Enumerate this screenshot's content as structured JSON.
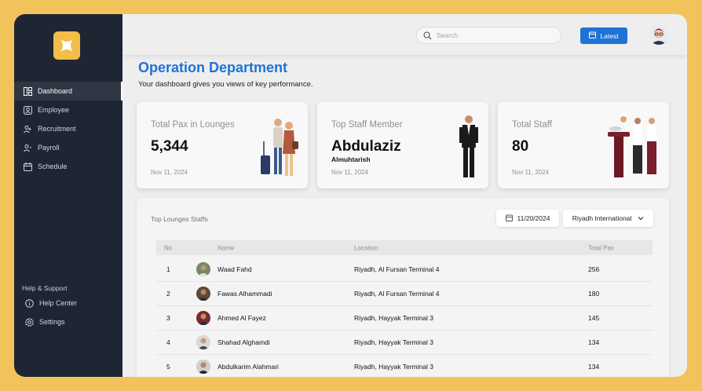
{
  "sidebar": {
    "items": [
      {
        "label": "Dashboard",
        "icon": "dashboard-icon",
        "active": true
      },
      {
        "label": "Employee",
        "icon": "employee-icon"
      },
      {
        "label": "Recruitment",
        "icon": "recruitment-icon"
      },
      {
        "label": "Payroll",
        "icon": "payroll-icon"
      },
      {
        "label": "Schedule",
        "icon": "schedule-icon"
      }
    ],
    "support_title": "Help & Support",
    "support_items": [
      {
        "label": "Help Center",
        "icon": "info-icon"
      },
      {
        "label": "Settings",
        "icon": "gear-icon"
      }
    ]
  },
  "header": {
    "search_placeholder": "Search",
    "latest_label": "Latest"
  },
  "page": {
    "title": "Operation Department",
    "subtitle": "Your dashboard gives you views of key performance."
  },
  "cards": [
    {
      "label": "Total Pax in Lounges",
      "value": "5,344",
      "sub": "",
      "date": "Nov 11, 2024"
    },
    {
      "label": "Top Staff Member",
      "value": "Abdulaziz",
      "sub": "Almuhtarish",
      "date": "Nov 11, 2024"
    },
    {
      "label": "Total Staff",
      "value": "80",
      "sub": "",
      "date": "Nov 11, 2024"
    }
  ],
  "table": {
    "title": "Top Lounges Staffs",
    "date_filter": "11/20/2024",
    "location_filter": "Riyadh International",
    "columns": [
      "No",
      "Name",
      "Location",
      "Total Pax"
    ],
    "rows": [
      {
        "no": "1",
        "name": "Waad Fahd",
        "location": "Riyadh, Al Fursan Terminal 4",
        "pax": "256"
      },
      {
        "no": "2",
        "name": "Fawas Alhammadi",
        "location": "Riyadh, Al Fursan Terminal 4",
        "pax": "180"
      },
      {
        "no": "3",
        "name": "Ahmed Al Fayez",
        "location": "Riyadh, Hayyak Terminal 3",
        "pax": "145"
      },
      {
        "no": "4",
        "name": "Shahad Alghamdi",
        "location": "Riyadh, Hayyak Terminal 3",
        "pax": "134"
      },
      {
        "no": "5",
        "name": "Abdulkarim Alahmari",
        "location": "Riyadh, Hayyak Terminal 3",
        "pax": "134"
      }
    ]
  },
  "colors": {
    "accent": "#1f73d6",
    "frame": "#f2c35a",
    "sidebar": "#1f2633"
  }
}
